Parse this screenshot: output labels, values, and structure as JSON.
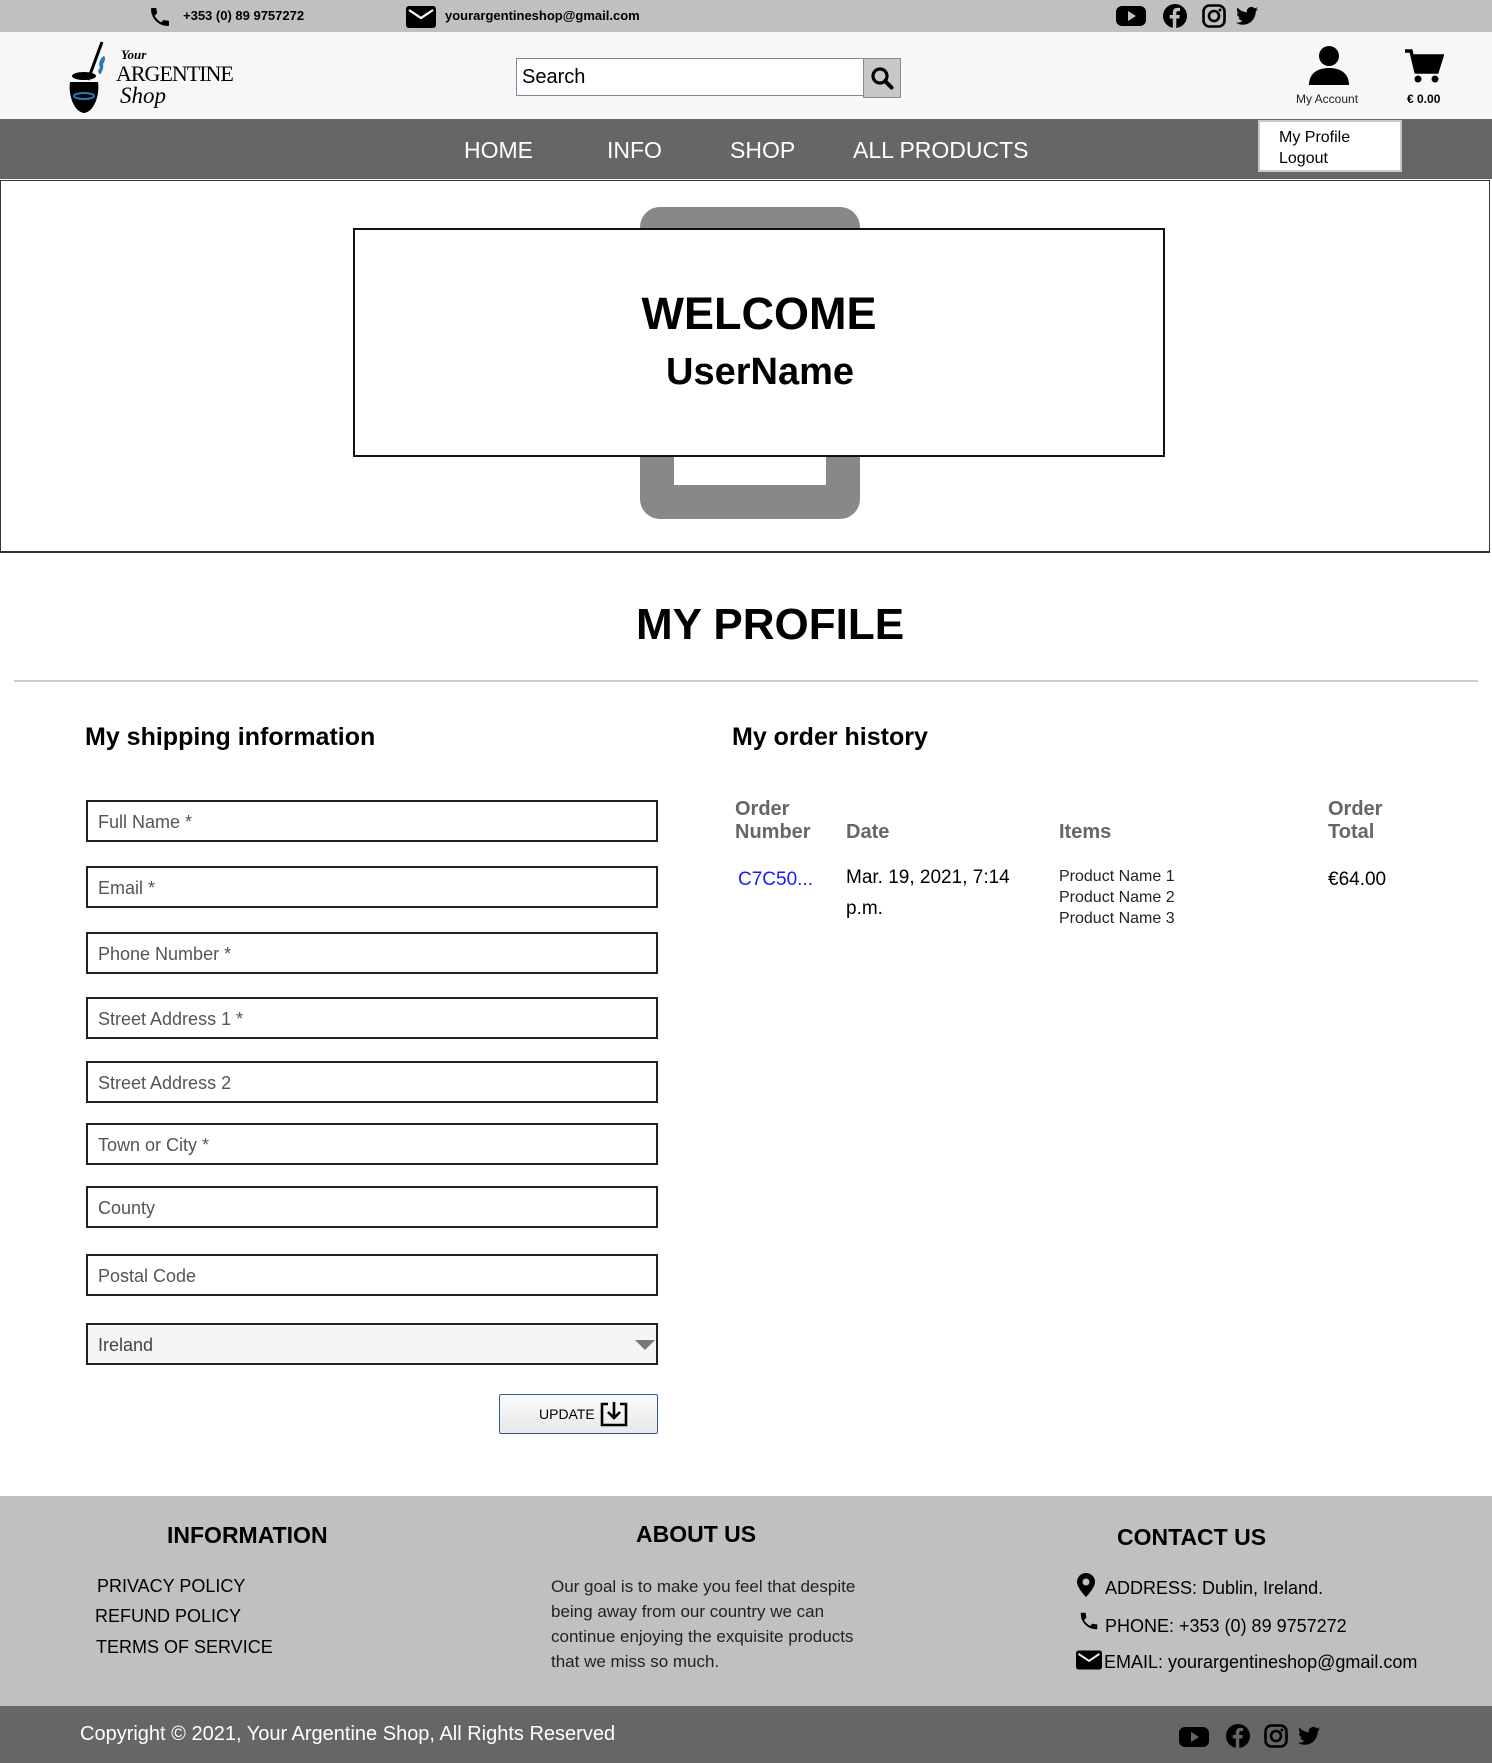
{
  "topbar": {
    "phone": "+353 (0) 89 9757272",
    "email": "yourargentineshop@gmail.com",
    "social_icons": [
      "youtube-icon",
      "facebook-icon",
      "instagram-icon",
      "twitter-icon"
    ]
  },
  "header": {
    "logo": {
      "line1": "Your",
      "line2": "ARGENTINE",
      "line3": "Shop"
    },
    "search_placeholder": "Search",
    "account_label": "My Account",
    "cart_total": "€ 0.00"
  },
  "nav": {
    "items": [
      "HOME",
      "INFO",
      "SHOP",
      "ALL PRODUCTS"
    ],
    "dropdown": [
      "My Profile",
      "Logout"
    ]
  },
  "hero": {
    "title": "WELCOME",
    "subtitle": "UserName"
  },
  "profile": {
    "title": "MY PROFILE",
    "shipping_title": "My shipping information",
    "fields": [
      "Full Name *",
      "Email *",
      "Phone Number *",
      "Street Address 1 *",
      "Street Address 2",
      "Town or City *",
      "County",
      "Postal Code"
    ],
    "country": "Ireland",
    "update_label": "UPDATE"
  },
  "orders": {
    "title": "My order history",
    "headers": {
      "order_number": [
        "Order",
        "Number"
      ],
      "date": "Date",
      "items": "Items",
      "total": [
        "Order",
        "Total"
      ]
    },
    "rows": [
      {
        "number": "C7C50...",
        "date": [
          "Mar. 19, 2021, 7:14",
          "p.m."
        ],
        "items": [
          "Product Name 1",
          "Product Name 2",
          "Product Name 3"
        ],
        "total": "€64.00"
      }
    ]
  },
  "footer": {
    "information": {
      "title": "INFORMATION",
      "links": [
        "PRIVACY POLICY",
        "REFUND POLICY",
        "TERMS OF SERVICE"
      ]
    },
    "about": {
      "title": "ABOUT US",
      "lines": [
        "Our goal is to make you feel that despite",
        "being away from our country we can",
        "continue enjoying the exquisite products",
        "that we miss so much."
      ]
    },
    "contact": {
      "title": "CONTACT US",
      "address": "ADDRESS: Dublin, Ireland.",
      "phone": "PHONE: +353 (0) 89 9757272",
      "email": "EMAIL: yourargentineshop@gmail.com"
    },
    "copyright": "Copyright © 2021, Your Argentine Shop, All Rights Reserved"
  },
  "colors": {
    "topbar": "#c0c0c0",
    "nav": "#666666",
    "link": "#1a1aff",
    "footer": "#c0c0c0"
  }
}
